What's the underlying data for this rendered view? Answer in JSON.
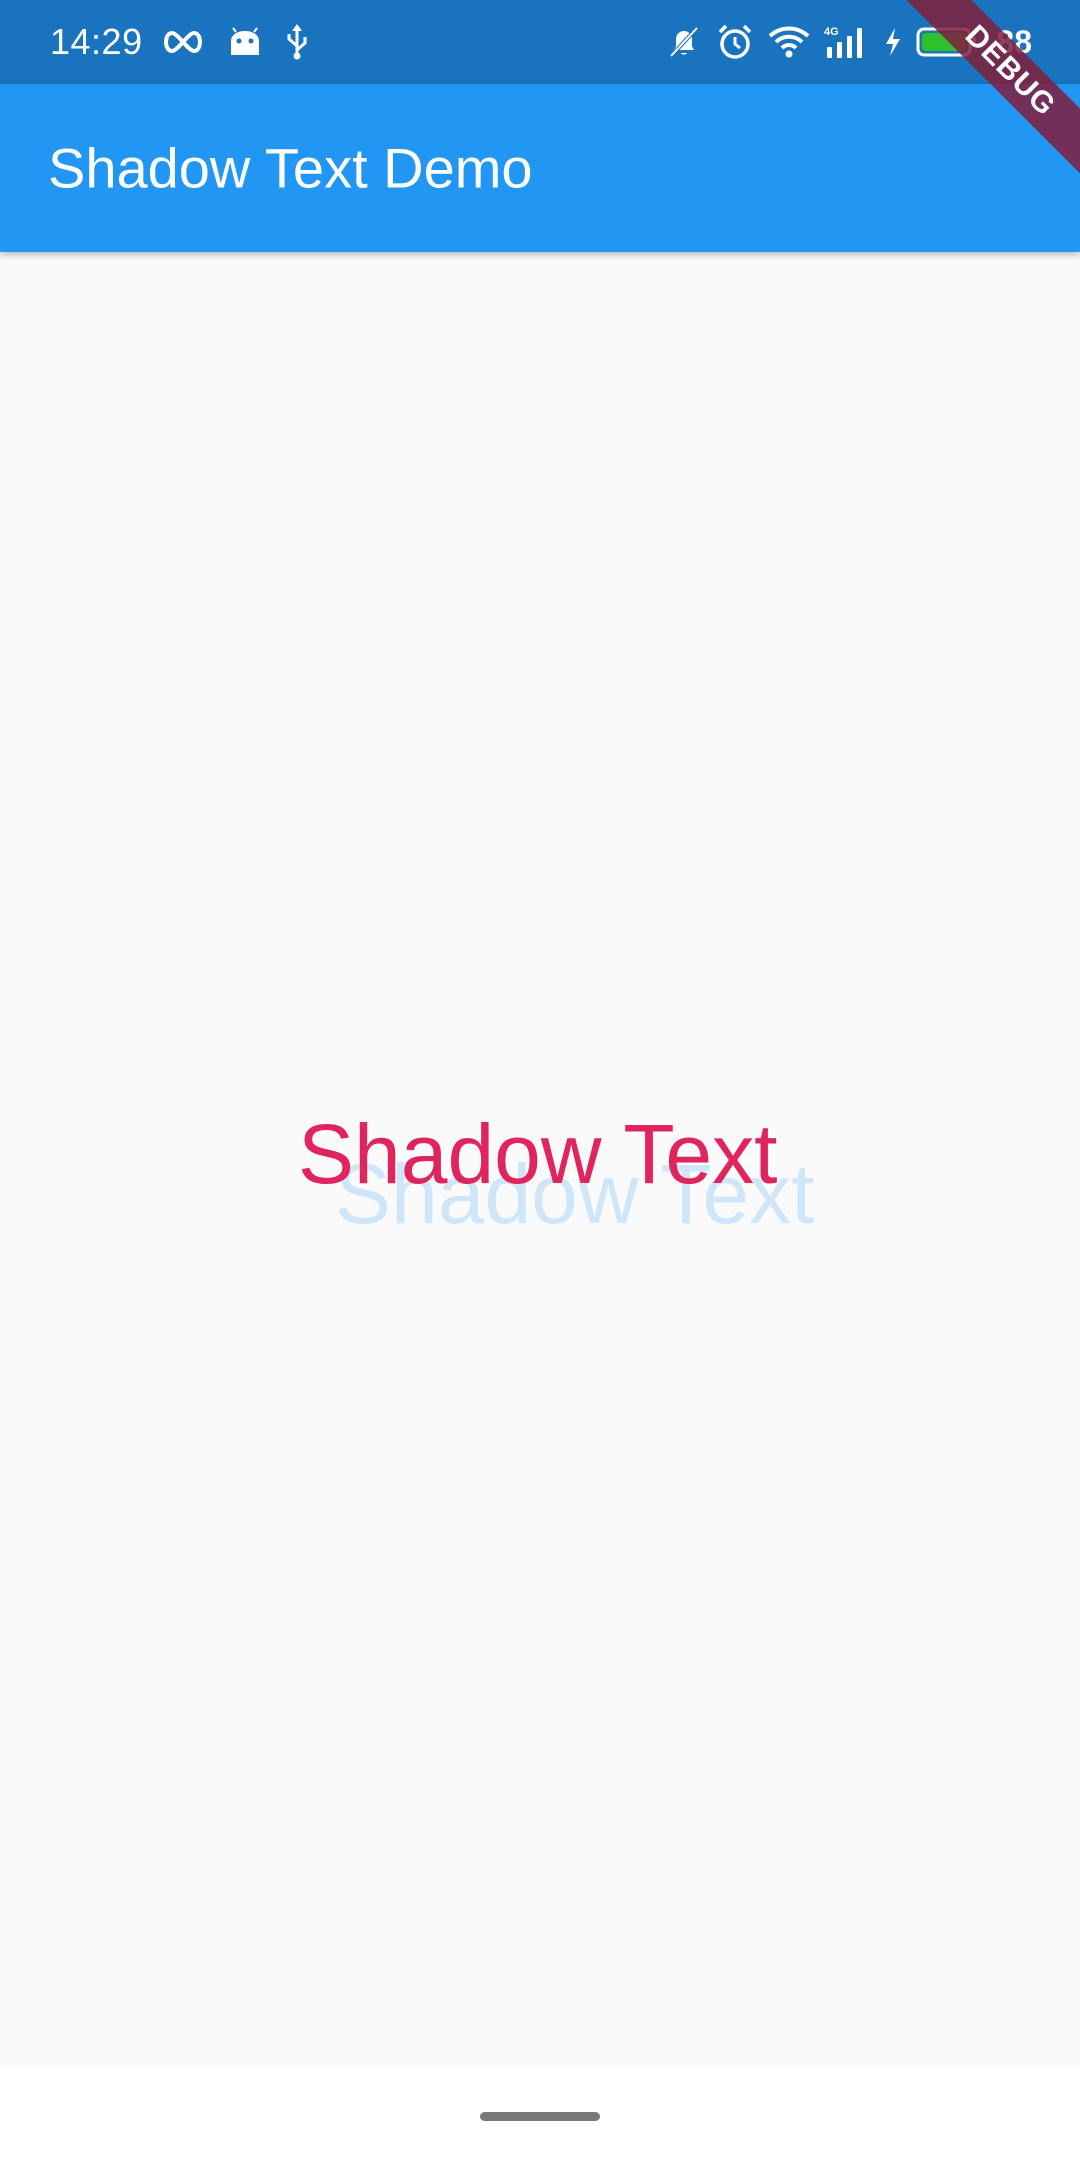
{
  "status_bar": {
    "time": "14:29",
    "battery_level": "88",
    "left_icons": [
      "infinity-icon",
      "android-icon",
      "usb-icon"
    ],
    "right_icons": [
      "bell-off-icon",
      "alarm-icon",
      "wifi-icon",
      "signal-4g-icon",
      "charging-icon",
      "battery-icon"
    ],
    "background_color": "#1a73be"
  },
  "app_bar": {
    "title": "Shadow Text Demo",
    "background_color": "#2196f3"
  },
  "main": {
    "shadow_text": "Shadow Text",
    "text_color": "#e0245e",
    "shadow_color": "#cfe5f8"
  },
  "debug_banner": {
    "label": "DEBUG"
  }
}
